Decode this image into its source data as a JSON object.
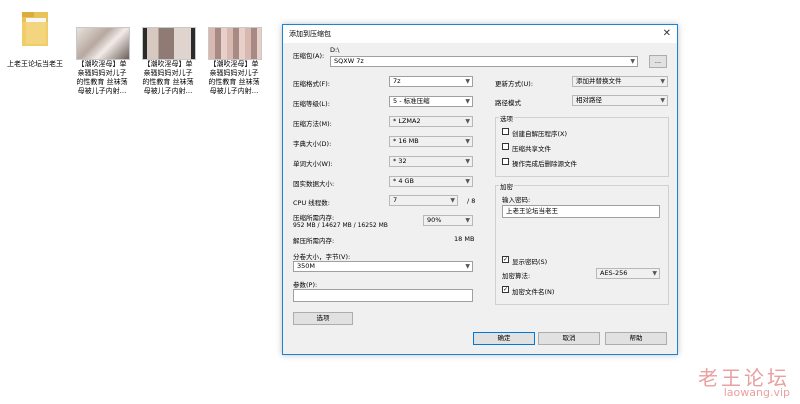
{
  "desktop": {
    "folder_label": "上老王论坛当老王",
    "files": [
      {
        "label_l1": "【潮吹淫母】单",
        "label_l2": "亲骚妈妈对儿子",
        "label_l3": "的性教育 丝袜荡",
        "label_l4": "母被儿子内射..."
      },
      {
        "label_l1": "【潮吹淫母】单",
        "label_l2": "亲骚妈妈对儿子",
        "label_l3": "的性教育 丝袜荡",
        "label_l4": "母被儿子内射..."
      },
      {
        "label_l1": "【潮吹淫母】单",
        "label_l2": "亲骚妈妈对儿子",
        "label_l3": "的性教育 丝袜荡",
        "label_l4": "母被儿子内射..."
      }
    ]
  },
  "dialog": {
    "title": "添加到压缩包",
    "archive_label": "压缩包(A):",
    "archive_path": "D:\\",
    "archive_name": "SQXW 7z",
    "browse_label": "...",
    "format_label": "压缩格式(F):",
    "format_value": "7z",
    "level_label": "压缩等级(L):",
    "level_value": "5 - 标准压缩",
    "method_label": "压缩方法(M):",
    "method_value": "* LZMA2",
    "dict_label": "字典大小(D):",
    "dict_value": "* 16 MB",
    "word_label": "单词大小(W):",
    "word_value": "* 32",
    "solid_label": "固实数据大小:",
    "solid_value": "* 4 GB",
    "cpu_label": "CPU 线程数:",
    "cpu_value": "7",
    "cpu_max": "/ 8",
    "mem_label": "压缩所需内存:",
    "mem_detail": "952 MB / 14627 MB / 16252 MB",
    "mem_percent": "90%",
    "decomp_label": "解压所需内存:",
    "decomp_value": "18 MB",
    "split_label": "分卷大小，字节(V):",
    "split_value": "350M",
    "params_label": "参数(P):",
    "params_value": "",
    "options_button": "选项",
    "update_label": "更新方式(U):",
    "update_value": "添加并替换文件",
    "pathmode_label": "路径模式",
    "pathmode_value": "相对路径",
    "options_group": "选项",
    "opt_sfx": "创建自解压程序(X)",
    "opt_shared": "压缩共享文件",
    "opt_delete": "操作完成后删除源文件",
    "encrypt_group": "加密",
    "password_label": "输入密码:",
    "password_value": "上老王论坛当老王",
    "show_password": "显示密码(S)",
    "enc_method_label": "加密算法:",
    "enc_method_value": "AES-256",
    "encrypt_names": "加密文件名(N)",
    "ok_button": "确定",
    "cancel_button": "取消",
    "help_button": "帮助"
  },
  "watermark": {
    "line1": "老王论坛",
    "line2": "laowang.vip"
  },
  "colors": {
    "accent": "#0078d7",
    "dialog_bg": "#f0f0f0",
    "watermark": "#e8a0a0"
  }
}
